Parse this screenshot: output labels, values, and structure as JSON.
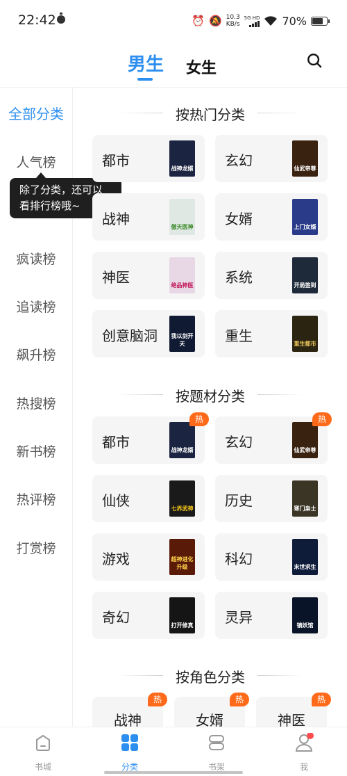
{
  "status": {
    "time": "22:42",
    "net_speed_value": "10.3",
    "net_speed_unit": "KB/s",
    "signal_label": "5G HD",
    "battery": "70%"
  },
  "header": {
    "tab_male": "男生",
    "tab_female": "女生"
  },
  "sidebar": {
    "items": [
      {
        "label": "全部分类"
      },
      {
        "label": "人气榜"
      },
      {
        "label": "疯读榜"
      },
      {
        "label": "追读榜"
      },
      {
        "label": "飙升榜"
      },
      {
        "label": "热搜榜"
      },
      {
        "label": "新书榜"
      },
      {
        "label": "热评榜"
      },
      {
        "label": "打赏榜"
      }
    ],
    "tooltip_line1": "除了分类，还可以",
    "tooltip_line2": "看排行榜哦~"
  },
  "sections": {
    "hot": {
      "title": "按热门分类",
      "cards": [
        {
          "label": "都市",
          "cover_text": "战神龙婿",
          "cover_color": "#1b2440"
        },
        {
          "label": "玄幻",
          "cover_text": "仙武帝尊",
          "cover_color": "#3a2210"
        },
        {
          "label": "战神",
          "cover_text": "傲天医神",
          "cover_color": "#eef3f0"
        },
        {
          "label": "女婿",
          "cover_text": "上门女婿",
          "cover_color": "#2a3b8a"
        },
        {
          "label": "神医",
          "cover_text": "绝品神医",
          "cover_color": "#e8d8e6"
        },
        {
          "label": "系统",
          "cover_text": "开局签到",
          "cover_color": "#1e2a3a"
        },
        {
          "label": "创意脑洞",
          "cover_text": "我以剑开天",
          "cover_color": "#101a33"
        },
        {
          "label": "重生",
          "cover_text": "重生都市",
          "cover_color": "#2a2410"
        }
      ]
    },
    "theme": {
      "title": "按题材分类",
      "hot_badge": "热",
      "cards": [
        {
          "label": "都市",
          "cover_text": "战神龙婿",
          "cover_color": "#1b2440",
          "hot": true
        },
        {
          "label": "玄幻",
          "cover_text": "仙武帝尊",
          "cover_color": "#3a2210",
          "hot": true
        },
        {
          "label": "仙侠",
          "cover_text": "七界武神",
          "cover_color": "#1a1a1a",
          "hot": false
        },
        {
          "label": "历史",
          "cover_text": "寒门枭士",
          "cover_color": "#3b3526",
          "hot": false
        },
        {
          "label": "游戏",
          "cover_text": "超神进化升级",
          "cover_color": "#5a1a08",
          "hot": false
        },
        {
          "label": "科幻",
          "cover_text": "末世求生",
          "cover_color": "#0e1c3a",
          "hot": false
        },
        {
          "label": "奇幻",
          "cover_text": "打开修真",
          "cover_color": "#151515",
          "hot": false
        },
        {
          "label": "灵异",
          "cover_text": "镇妖馆",
          "cover_color": "#0a1428",
          "hot": false
        }
      ]
    },
    "role": {
      "title": "按角色分类",
      "hot_badge": "热",
      "cards": [
        {
          "label": "战神"
        },
        {
          "label": "女婿"
        },
        {
          "label": "神医"
        }
      ]
    }
  },
  "bottom_nav": {
    "items": [
      {
        "label": "书城",
        "icon": "bookstore-icon"
      },
      {
        "label": "分类",
        "icon": "category-icon"
      },
      {
        "label": "书架",
        "icon": "bookshelf-icon"
      },
      {
        "label": "我",
        "icon": "profile-icon"
      }
    ],
    "accent": "#2c8ff0"
  }
}
